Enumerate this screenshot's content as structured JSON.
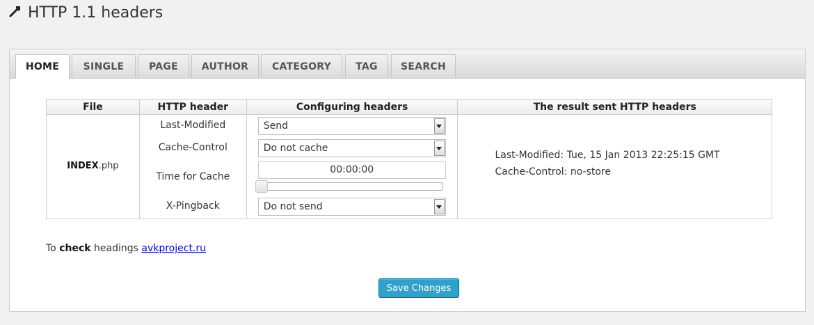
{
  "page": {
    "title": "HTTP 1.1 headers"
  },
  "tabs": [
    {
      "label": "HOME",
      "active": true
    },
    {
      "label": "SINGLE"
    },
    {
      "label": "PAGE"
    },
    {
      "label": "AUTHOR"
    },
    {
      "label": "CATEGORY"
    },
    {
      "label": "TAG"
    },
    {
      "label": "SEARCH"
    }
  ],
  "table": {
    "headers": [
      "File",
      "HTTP header",
      "Configuring headers",
      "The result sent HTTP headers"
    ],
    "file": {
      "name": "INDEX",
      "ext": ".php"
    },
    "header_names": [
      "Last-Modified",
      "Cache-Control",
      "Time for Cache",
      "X-Pingback"
    ],
    "last_modified_value": "Send",
    "cache_control_value": "Do not cache",
    "time_for_cache_value": "00:00:00",
    "time_for_cache_slider": 0,
    "x_pingback_value": "Do not send",
    "result_lines": [
      "Last-Modified: Tue, 15 Jan 2013 22:25:15 GMT",
      "Cache-Control: no-store"
    ]
  },
  "check": {
    "prefix": "To ",
    "bold": "check",
    "middle": " headings ",
    "link": "avkproject.ru"
  },
  "save_button": "Save Changes",
  "icons": {
    "title": "wrench-icon"
  }
}
